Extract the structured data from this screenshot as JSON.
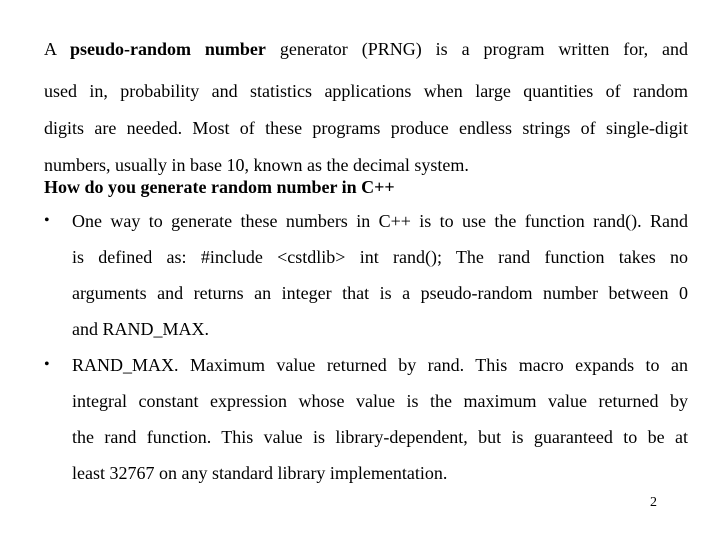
{
  "slide": {
    "intro": {
      "line1_prefix": "A ",
      "line1_bold": "pseudo-random number",
      "line1_suffix": " generator (PRNG) is a program written for, and",
      "line2": "used in, probability and statistics applications when large quantities of random",
      "line3": "digits are needed. Most of these programs produce endless strings of single-digit",
      "line4": "numbers, usually in base 10, known as the decimal system."
    },
    "heading": "How do you generate random number in C++",
    "bullets": [
      {
        "symbol": "•",
        "lines": [
          "One way to generate these numbers in C++ is to use the function rand(). Rand",
          "is defined as: #include <cstdlib> int rand(); The rand function takes no",
          "arguments and returns an integer that is a pseudo-random number between 0",
          "and RAND_MAX."
        ]
      },
      {
        "symbol": "•",
        "lines": [
          "RAND_MAX. Maximum value returned by rand. This macro expands to an",
          "integral constant expression whose value is the maximum value returned by",
          "the rand function. This value is library-dependent, but is guaranteed to be at",
          "least 32767 on any standard library implementation."
        ]
      }
    ],
    "page_number": "2"
  }
}
